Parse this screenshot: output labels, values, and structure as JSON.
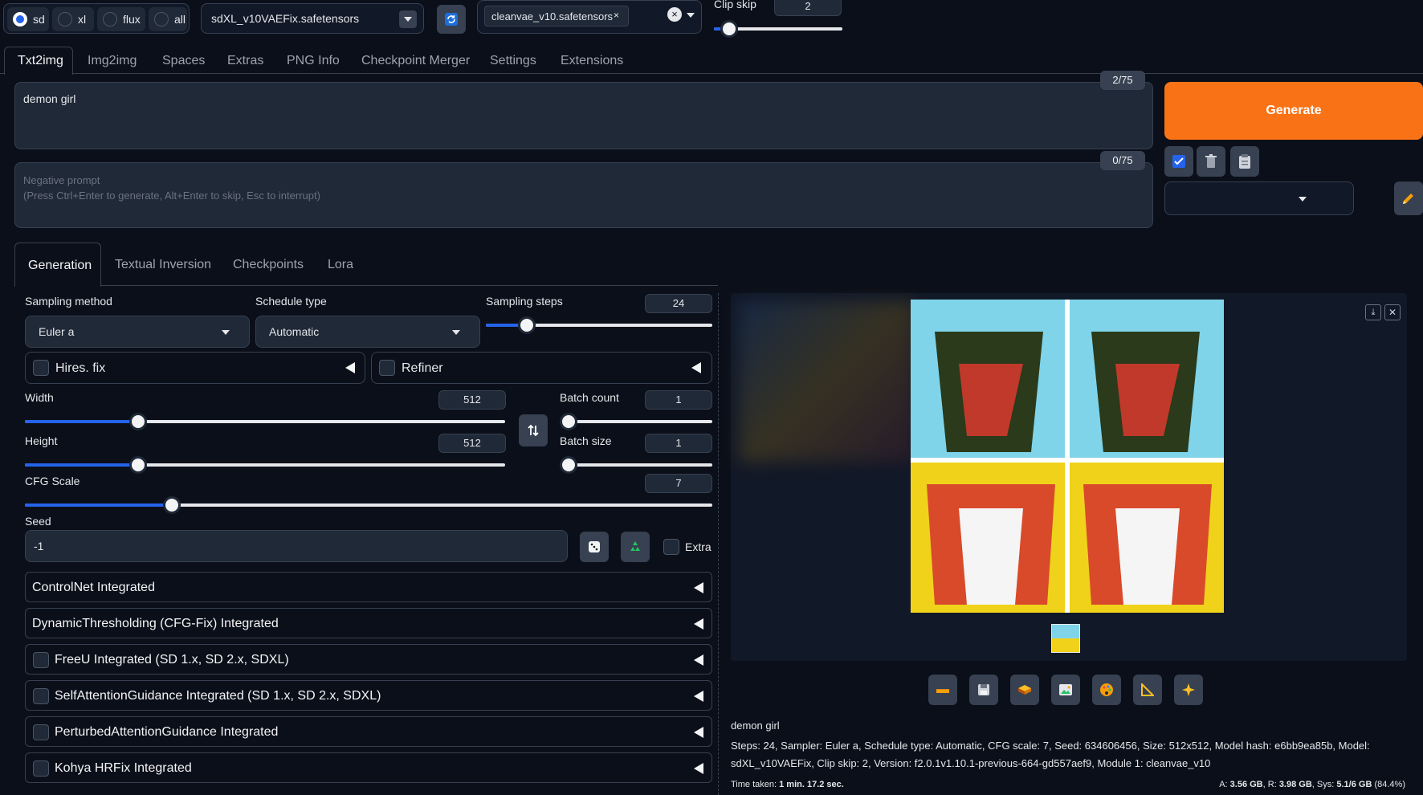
{
  "ui_type": {
    "options": [
      "sd",
      "xl",
      "flux",
      "all"
    ],
    "selected": "sd"
  },
  "checkpoint": {
    "value": "sdXL_v10VAEFix.safetensors"
  },
  "vae": {
    "chip": "cleanvae_v10.safetensors"
  },
  "clip_skip": {
    "label": "Clip skip",
    "value": "2",
    "fraction": 0.1
  },
  "main_tabs": [
    "Txt2img",
    "Img2img",
    "Spaces",
    "Extras",
    "PNG Info",
    "Checkpoint Merger",
    "Settings",
    "Extensions"
  ],
  "active_main_tab": "Txt2img",
  "prompt": {
    "value": "demon girl",
    "counter": "2/75"
  },
  "negative_prompt": {
    "placeholder": "Negative prompt\n(Press Ctrl+Enter to generate, Alt+Enter to skip, Esc to interrupt)",
    "counter": "0/75"
  },
  "generate_label": "Generate",
  "sub_tabs": [
    "Generation",
    "Textual Inversion",
    "Checkpoints",
    "Lora"
  ],
  "sampling": {
    "method_label": "Sampling method",
    "method": "Euler a",
    "schedule_label": "Schedule type",
    "schedule": "Automatic",
    "steps_label": "Sampling steps",
    "steps": "24"
  },
  "hires_label": "Hires. fix",
  "refiner_label": "Refiner",
  "width": {
    "label": "Width",
    "value": "512"
  },
  "height": {
    "label": "Height",
    "value": "512"
  },
  "batch_count": {
    "label": "Batch count",
    "value": "1"
  },
  "batch_size": {
    "label": "Batch size",
    "value": "1"
  },
  "cfg": {
    "label": "CFG Scale",
    "value": "7"
  },
  "seed": {
    "label": "Seed",
    "value": "-1",
    "extra_label": "Extra"
  },
  "accordions": [
    {
      "label": "ControlNet Integrated",
      "checkbox": false
    },
    {
      "label": "DynamicThresholding (CFG-Fix) Integrated",
      "checkbox": false
    },
    {
      "label": "FreeU Integrated (SD 1.x, SD 2.x, SDXL)",
      "checkbox": true
    },
    {
      "label": "SelfAttentionGuidance Integrated (SD 1.x, SD 2.x, SDXL)",
      "checkbox": true
    },
    {
      "label": "PerturbedAttentionGuidance Integrated",
      "checkbox": true
    },
    {
      "label": "Kohya HRFix Integrated",
      "checkbox": true
    }
  ],
  "output": {
    "prompt": "demon girl",
    "params": "Steps: 24, Sampler: Euler a, Schedule type: Automatic, CFG scale: 7, Seed: 634606456, Size: 512x512, Model hash: e6bb9ea85b, Model: sdXL_v10VAEFix, Clip skip: 2, Version: f2.0.1v1.10.1-previous-664-gd557aef9, Module 1: cleanvae_v10",
    "time_label": "Time taken:",
    "time_value": "1 min. 17.2 sec.",
    "mem_a_label": "A:",
    "mem_a": "3.56 GB",
    "mem_r_label": "R:",
    "mem_r": "3.98 GB",
    "mem_sys_label": "Sys:",
    "mem_sys": "5.1/6 GB",
    "mem_pct": "(84.4%)"
  },
  "colors": {
    "accent": "#2563eb",
    "generate": "#f97316",
    "bg": "#0b0f19"
  }
}
